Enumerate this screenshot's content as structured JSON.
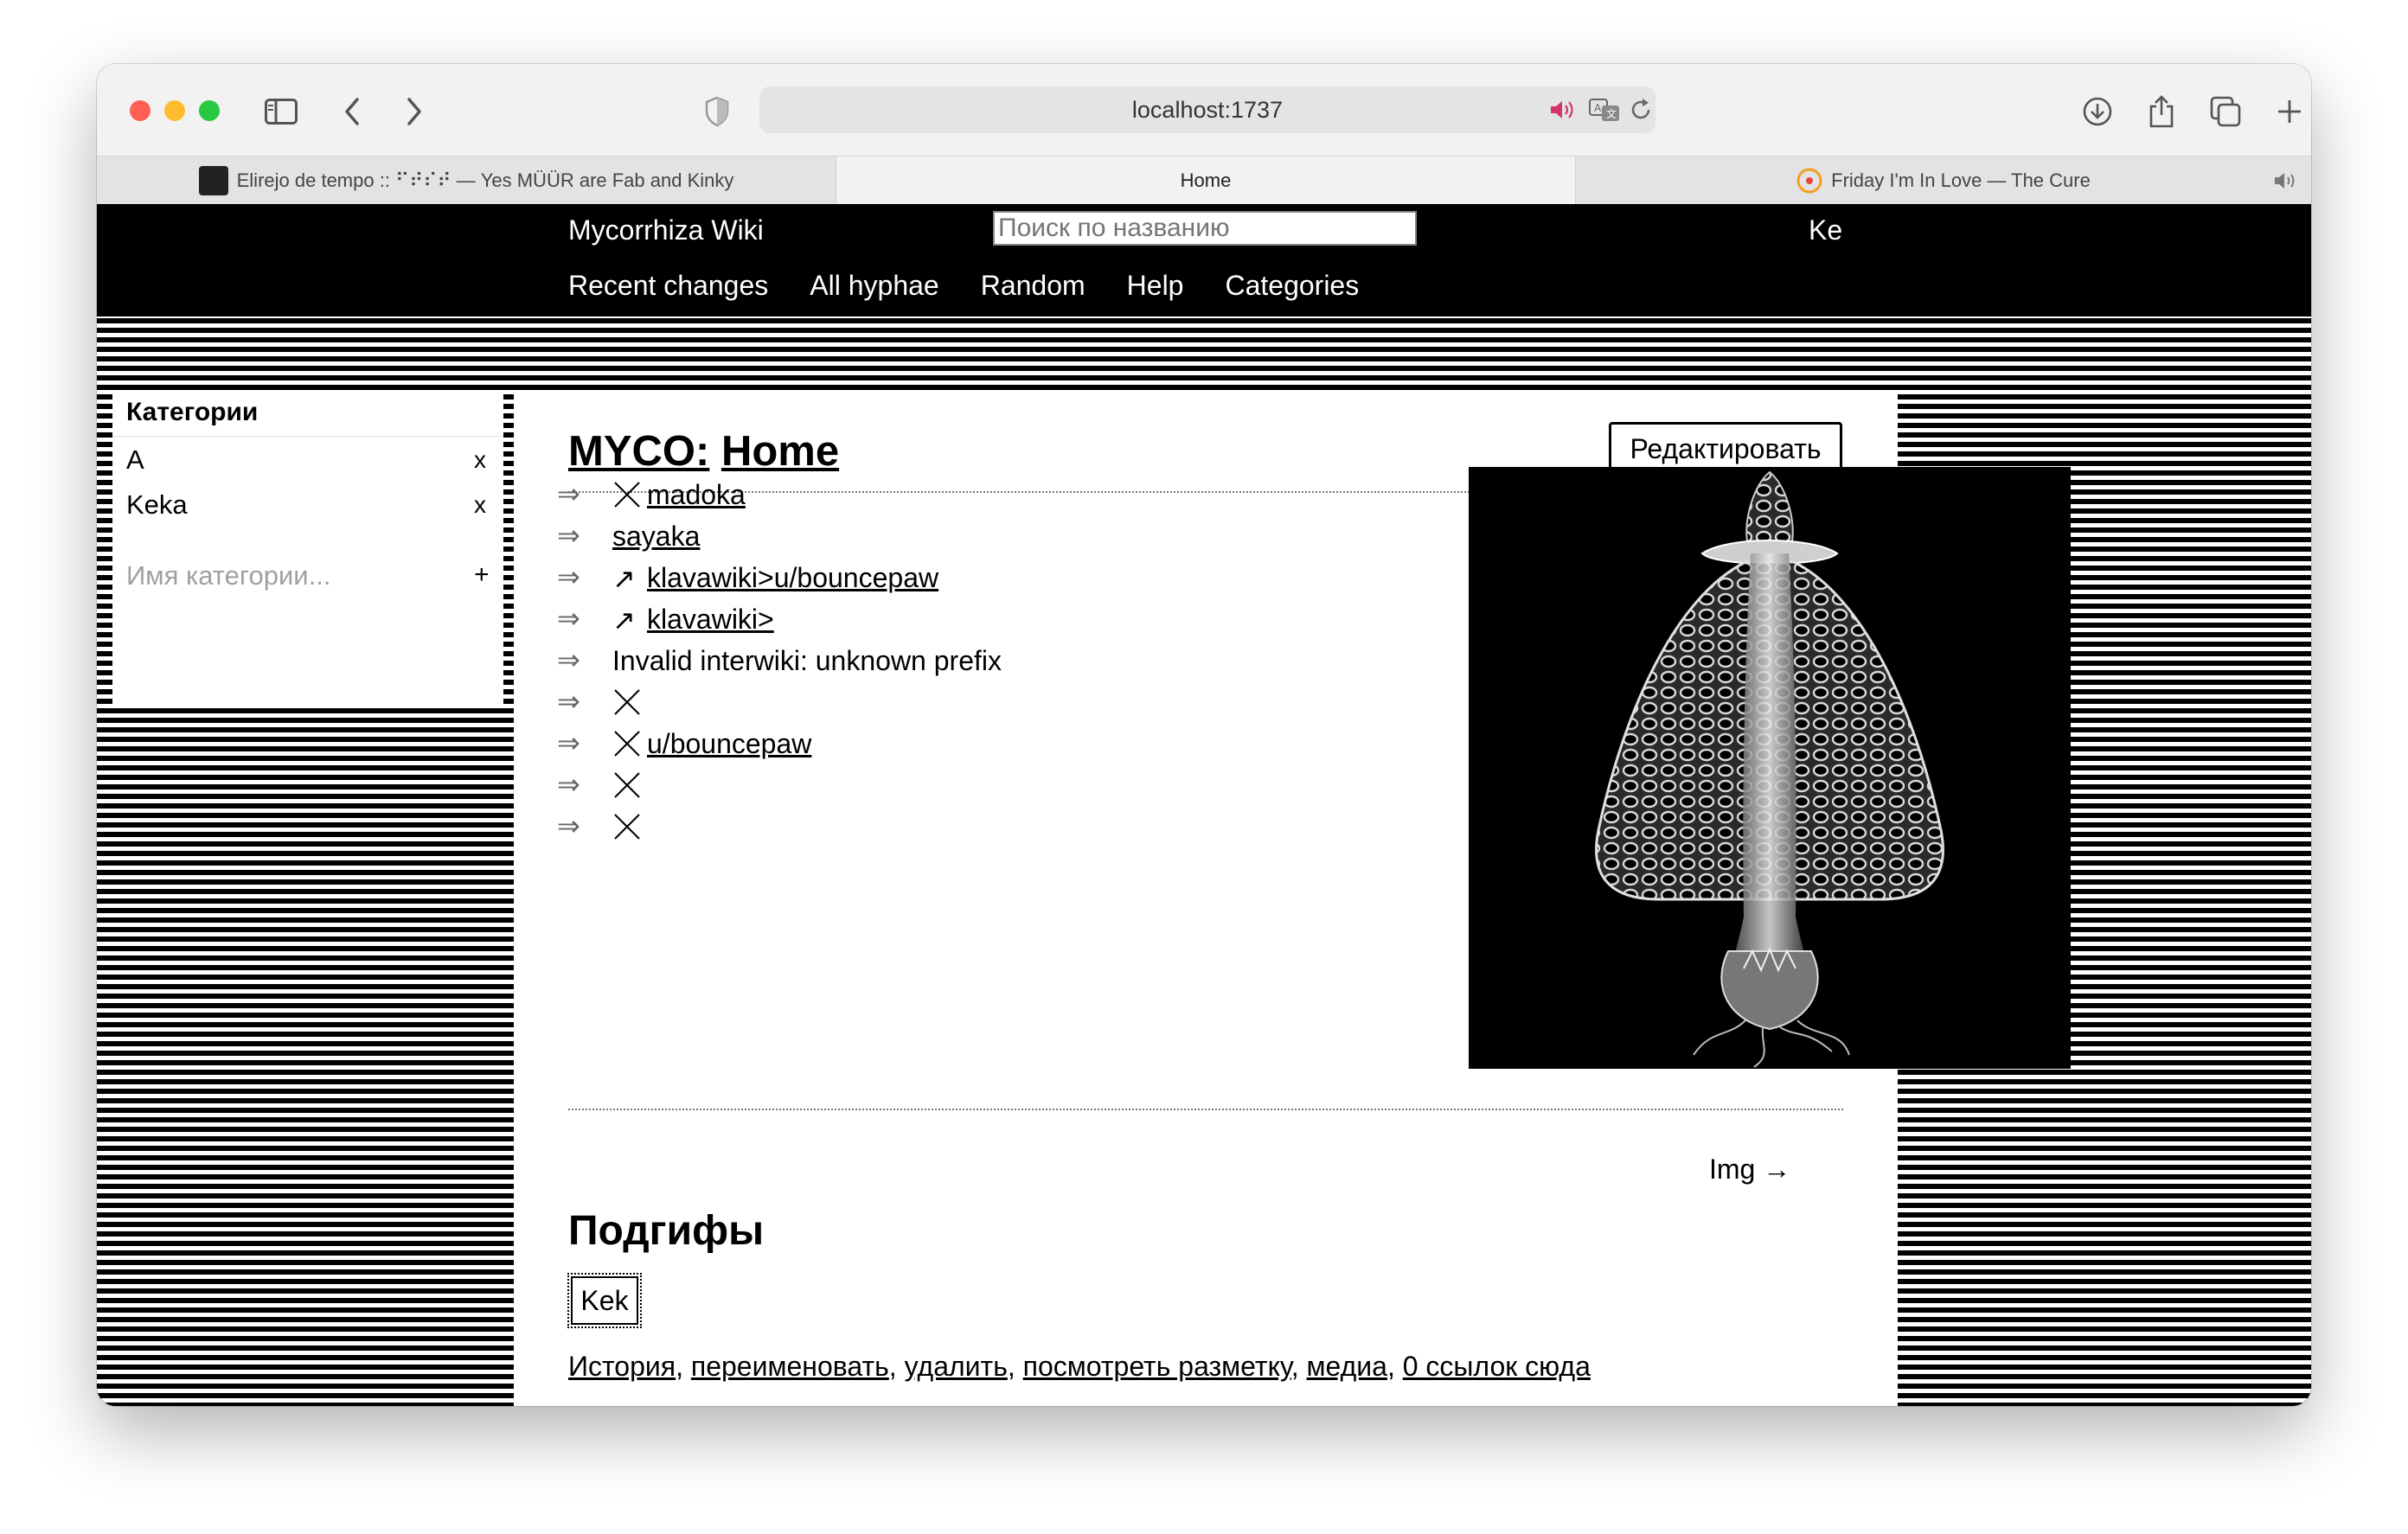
{
  "browser": {
    "url": "localhost:1737",
    "tabs": [
      {
        "label": "Elirejo de tempo :: ⠋⠞⠎⠞ — Yes MÜÜR are Fab and Kinky",
        "active": false
      },
      {
        "label": "Home",
        "active": true
      },
      {
        "label": "Friday I'm In Love — The Cure",
        "active": false
      }
    ],
    "traffic_colors": [
      "#ff5f57",
      "#febc2e",
      "#28c840"
    ]
  },
  "header": {
    "site_title": "Mycorrhiza Wiki",
    "search_placeholder": "Поиск по названию",
    "user": "Ke",
    "nav": [
      "Recent changes",
      "All hyphae",
      "Random",
      "Help",
      "Categories"
    ]
  },
  "categories": {
    "title": "Категории",
    "items": [
      {
        "label": "A",
        "remove": "x"
      },
      {
        "label": "Keka",
        "remove": "x"
      }
    ],
    "input_placeholder": "Имя категории...",
    "add": "+"
  },
  "main": {
    "title_prefix": "MYCO:",
    "title": "Home",
    "edit_label": "Редактировать",
    "arrow_glyph": "⇒",
    "links": [
      {
        "icon": "cross",
        "text": "madoka",
        "link": true
      },
      {
        "icon": "",
        "text": "sayaka",
        "link": true
      },
      {
        "icon": "↗",
        "text": "klavawiki>u/bouncepaw",
        "link": true
      },
      {
        "icon": "↗",
        "text": "klavawiki>",
        "link": true
      },
      {
        "icon": "",
        "text": "Invalid interwiki: unknown prefix",
        "link": false
      },
      {
        "icon": "cross",
        "text": "",
        "link": false
      },
      {
        "icon": "cross",
        "text": "u/bouncepaw",
        "link": true
      },
      {
        "icon": "cross",
        "text": "",
        "link": false
      },
      {
        "icon": "cross",
        "text": "",
        "link": false
      }
    ],
    "next_hypha": "Img →",
    "subhyphae_title": "Подгифы",
    "subhyphae": [
      "Kek"
    ],
    "footer_links": [
      "История",
      "переименовать",
      "удалить",
      "посмотреть разметку",
      "медиа",
      "0 ссылок сюда"
    ]
  }
}
